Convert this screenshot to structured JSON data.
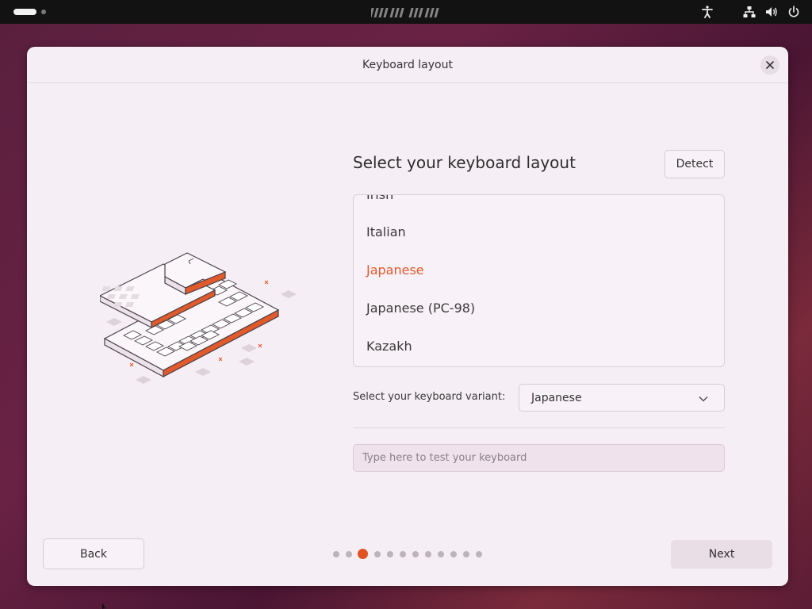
{
  "topbar": {
    "clock_text": "(blurred)",
    "icons": [
      "accessibility-icon",
      "network-icon",
      "volume-icon",
      "power-icon"
    ]
  },
  "dialog": {
    "title": "Keyboard layout"
  },
  "main": {
    "heading": "Select your keyboard layout",
    "detect_label": "Detect",
    "layouts": [
      {
        "label": "Irish",
        "selected": false
      },
      {
        "label": "Italian",
        "selected": false
      },
      {
        "label": "Japanese",
        "selected": true
      },
      {
        "label": "Japanese (PC-98)",
        "selected": false
      },
      {
        "label": "Kazakh",
        "selected": false
      }
    ],
    "variant_label": "Select your keyboard variant:",
    "variant_value": "Japanese",
    "test_placeholder": "Type here to test your keyboard"
  },
  "footer": {
    "back_label": "Back",
    "next_label": "Next",
    "steps_total": 12,
    "current_step": 3
  },
  "colors": {
    "accent": "#e05a2b",
    "dialog_bg": "#f6eef5"
  }
}
